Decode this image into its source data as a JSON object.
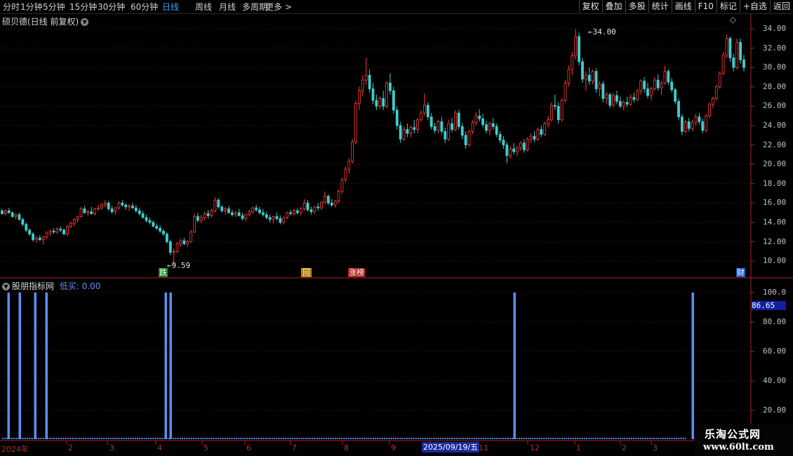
{
  "toolbar": {
    "periods": [
      "分时",
      "1分钟",
      "5分钟",
      "15分钟",
      "30分钟",
      "60分钟",
      "日线",
      "周线",
      "月线",
      "多周期",
      "更多 >"
    ],
    "active_period": "日线",
    "right_buttons": [
      "复权",
      "叠加",
      "多股",
      "统计",
      "画线",
      "F10",
      "标记",
      "+自选",
      "返回"
    ]
  },
  "main_panel": {
    "title": "硕贝德(日线 前复权)",
    "y_ticks": [
      "34.00",
      "32.00",
      "30.00",
      "28.00",
      "26.00",
      "24.00",
      "22.00",
      "20.00",
      "18.00",
      "16.00",
      "14.00",
      "12.00",
      "10.00"
    ],
    "max_label": "34.00",
    "min_label": "9.59",
    "event_tags": [
      {
        "text": "跌",
        "bg": "#1a8a1a"
      },
      {
        "text": "回",
        "bg": "#a07000"
      },
      {
        "text": "涨榜",
        "bg": "#b02020"
      },
      {
        "text": "财",
        "bg": "#1c5cc8"
      }
    ]
  },
  "indicator_panel": {
    "name": "股朋指标网",
    "series_label": "低买: 0.00",
    "y_ticks": [
      "100.0",
      "80.00",
      "60.00",
      "40.00",
      "20.00"
    ],
    "cursor_value": "86.65",
    "bar_color": "#5b8ff0"
  },
  "time_axis": {
    "labels": [
      "2024年",
      "2",
      "3",
      "4",
      "5",
      "6",
      "7",
      "8",
      "9",
      "11",
      "12",
      "1",
      "2",
      "3"
    ],
    "cursor_date": "2025/09/19/五"
  },
  "watermark": {
    "line1": "乐淘公式网",
    "line2": "www.60lt.com"
  },
  "chart_data": {
    "type": "candlestick",
    "title": "硕贝德(日线 前复权)",
    "ylim": [
      9.5,
      34.5
    ],
    "up_color": "#ff3c3c",
    "down_color": "#3ecfcf",
    "candles_ohlc": [
      [
        15.2,
        15.4,
        14.8,
        14.9
      ],
      [
        14.9,
        15.3,
        14.7,
        15.2
      ],
      [
        15.2,
        15.5,
        14.9,
        15.0
      ],
      [
        15.0,
        15.1,
        14.5,
        14.6
      ],
      [
        14.6,
        14.9,
        14.3,
        14.8
      ],
      [
        14.8,
        15.0,
        14.2,
        14.3
      ],
      [
        14.3,
        14.5,
        13.6,
        13.8
      ],
      [
        13.8,
        14.0,
        13.0,
        13.2
      ],
      [
        13.2,
        13.4,
        12.6,
        12.8
      ],
      [
        12.8,
        13.0,
        12.0,
        12.2
      ],
      [
        12.2,
        12.6,
        11.9,
        12.4
      ],
      [
        12.4,
        12.7,
        12.1,
        12.2
      ],
      [
        12.2,
        12.6,
        11.7,
        12.5
      ],
      [
        12.5,
        13.1,
        12.3,
        12.9
      ],
      [
        12.9,
        13.3,
        12.6,
        13.1
      ],
      [
        13.1,
        13.4,
        12.8,
        13.0
      ],
      [
        13.0,
        13.5,
        12.8,
        13.3
      ],
      [
        13.3,
        13.6,
        13.0,
        13.2
      ],
      [
        13.2,
        13.4,
        12.7,
        12.8
      ],
      [
        12.8,
        13.7,
        12.6,
        13.6
      ],
      [
        13.6,
        14.1,
        13.4,
        13.9
      ],
      [
        13.9,
        14.4,
        13.6,
        14.3
      ],
      [
        14.3,
        14.7,
        14.0,
        14.6
      ],
      [
        14.6,
        15.6,
        14.5,
        15.4
      ],
      [
        15.4,
        15.7,
        14.9,
        15.0
      ],
      [
        15.0,
        15.3,
        14.7,
        15.1
      ],
      [
        15.1,
        15.6,
        14.8,
        14.9
      ],
      [
        14.9,
        15.5,
        14.7,
        15.4
      ],
      [
        15.4,
        15.8,
        15.2,
        15.5
      ],
      [
        15.5,
        16.0,
        15.3,
        15.8
      ],
      [
        15.8,
        16.3,
        15.5,
        16.0
      ],
      [
        16.0,
        16.2,
        15.2,
        15.4
      ],
      [
        15.4,
        15.7,
        14.9,
        15.1
      ],
      [
        15.1,
        15.6,
        14.8,
        15.5
      ],
      [
        15.5,
        16.2,
        15.3,
        16.0
      ],
      [
        16.0,
        16.3,
        15.6,
        15.8
      ],
      [
        15.8,
        16.0,
        15.3,
        15.6
      ],
      [
        15.6,
        15.9,
        15.2,
        15.7
      ],
      [
        15.7,
        16.0,
        15.4,
        15.5
      ],
      [
        15.5,
        15.8,
        15.0,
        15.2
      ],
      [
        15.2,
        15.5,
        14.7,
        14.9
      ],
      [
        14.9,
        15.2,
        14.4,
        14.5
      ],
      [
        14.5,
        14.8,
        14.0,
        14.2
      ],
      [
        14.2,
        14.5,
        13.8,
        14.0
      ],
      [
        14.0,
        14.2,
        13.5,
        13.6
      ],
      [
        13.6,
        13.9,
        13.2,
        13.4
      ],
      [
        13.4,
        13.7,
        12.9,
        13.1
      ],
      [
        13.1,
        13.3,
        12.6,
        12.8
      ],
      [
        12.8,
        13.0,
        11.8,
        12.0
      ],
      [
        12.0,
        12.2,
        10.6,
        10.9
      ],
      [
        10.9,
        11.3,
        9.59,
        11.0
      ],
      [
        11.0,
        12.0,
        10.8,
        11.8
      ],
      [
        11.8,
        12.3,
        11.5,
        12.1
      ],
      [
        12.1,
        12.4,
        11.6,
        11.8
      ],
      [
        11.8,
        12.2,
        11.5,
        12.0
      ],
      [
        12.0,
        13.2,
        11.9,
        13.0
      ],
      [
        13.0,
        14.9,
        12.9,
        14.6
      ],
      [
        14.6,
        15.0,
        14.0,
        14.2
      ],
      [
        14.2,
        14.8,
        13.9,
        14.5
      ],
      [
        14.5,
        15.1,
        14.2,
        14.9
      ],
      [
        14.9,
        15.3,
        14.4,
        14.7
      ],
      [
        14.7,
        15.4,
        14.5,
        15.2
      ],
      [
        15.2,
        16.6,
        15.0,
        16.3
      ],
      [
        16.3,
        16.5,
        15.4,
        15.6
      ],
      [
        15.6,
        15.8,
        15.0,
        15.2
      ],
      [
        15.2,
        15.6,
        14.8,
        15.4
      ],
      [
        15.4,
        15.7,
        14.9,
        15.0
      ],
      [
        15.0,
        15.3,
        14.6,
        14.8
      ],
      [
        14.8,
        15.2,
        14.5,
        15.0
      ],
      [
        15.0,
        15.4,
        14.6,
        14.7
      ],
      [
        14.7,
        15.0,
        14.2,
        14.4
      ],
      [
        14.4,
        14.9,
        14.1,
        14.8
      ],
      [
        14.8,
        15.3,
        14.6,
        15.1
      ],
      [
        15.1,
        15.6,
        14.9,
        15.5
      ],
      [
        15.5,
        15.8,
        15.1,
        15.3
      ],
      [
        15.3,
        15.6,
        14.8,
        15.0
      ],
      [
        15.0,
        15.4,
        14.6,
        14.8
      ],
      [
        14.8,
        15.1,
        14.3,
        14.5
      ],
      [
        14.5,
        14.8,
        14.0,
        14.3
      ],
      [
        14.3,
        14.7,
        13.9,
        14.6
      ],
      [
        14.6,
        15.0,
        14.2,
        14.4
      ],
      [
        14.4,
        14.7,
        13.8,
        14.0
      ],
      [
        14.0,
        14.6,
        13.8,
        14.5
      ],
      [
        14.5,
        15.1,
        14.3,
        15.0
      ],
      [
        15.0,
        15.3,
        14.7,
        14.9
      ],
      [
        14.9,
        15.4,
        14.7,
        15.2
      ],
      [
        15.2,
        15.5,
        14.8,
        15.0
      ],
      [
        15.0,
        15.6,
        14.7,
        15.4
      ],
      [
        15.4,
        16.4,
        15.2,
        16.0
      ],
      [
        16.0,
        16.3,
        15.1,
        15.3
      ],
      [
        15.3,
        15.6,
        14.8,
        15.1
      ],
      [
        15.1,
        15.7,
        14.9,
        15.6
      ],
      [
        15.6,
        16.0,
        15.2,
        15.5
      ],
      [
        15.5,
        16.2,
        15.3,
        16.1
      ],
      [
        16.1,
        17.2,
        15.9,
        16.7
      ],
      [
        16.7,
        16.9,
        15.8,
        16.0
      ],
      [
        16.0,
        16.4,
        15.6,
        15.8
      ],
      [
        15.8,
        16.3,
        15.5,
        16.2
      ],
      [
        16.2,
        17.4,
        16.0,
        17.2
      ],
      [
        17.2,
        18.6,
        17.0,
        18.4
      ],
      [
        18.4,
        19.8,
        18.1,
        19.5
      ],
      [
        19.5,
        20.6,
        19.0,
        20.3
      ],
      [
        20.3,
        22.6,
        20.1,
        22.3
      ],
      [
        22.3,
        26.6,
        22.1,
        26.3
      ],
      [
        26.3,
        28.0,
        25.6,
        27.6
      ],
      [
        27.6,
        29.2,
        27.0,
        28.7
      ],
      [
        28.7,
        31.0,
        28.2,
        29.2
      ],
      [
        29.2,
        29.8,
        27.4,
        27.8
      ],
      [
        27.8,
        28.4,
        26.2,
        26.6
      ],
      [
        26.6,
        27.2,
        25.6,
        26.0
      ],
      [
        26.0,
        27.0,
        25.7,
        26.8
      ],
      [
        26.8,
        27.6,
        25.6,
        26.0
      ],
      [
        26.0,
        28.6,
        25.8,
        28.4
      ],
      [
        28.4,
        29.4,
        27.2,
        27.6
      ],
      [
        27.6,
        28.0,
        25.2,
        25.6
      ],
      [
        25.6,
        26.0,
        23.6,
        24.0
      ],
      [
        24.0,
        24.4,
        22.2,
        22.6
      ],
      [
        22.6,
        23.9,
        22.4,
        23.6
      ],
      [
        23.6,
        24.2,
        22.8,
        23.2
      ],
      [
        23.2,
        24.0,
        22.8,
        23.8
      ],
      [
        23.8,
        24.6,
        23.2,
        23.6
      ],
      [
        23.6,
        24.8,
        23.2,
        24.6
      ],
      [
        24.6,
        25.6,
        24.4,
        25.3
      ],
      [
        25.3,
        27.3,
        25.0,
        26.1
      ],
      [
        26.1,
        26.4,
        24.6,
        24.9
      ],
      [
        24.9,
        25.3,
        23.6,
        23.9
      ],
      [
        23.9,
        24.3,
        23.2,
        23.5
      ],
      [
        23.5,
        24.6,
        23.2,
        24.4
      ],
      [
        24.4,
        24.9,
        23.1,
        23.4
      ],
      [
        23.4,
        23.8,
        22.2,
        22.6
      ],
      [
        22.6,
        24.6,
        22.4,
        24.2
      ],
      [
        24.2,
        24.8,
        23.3,
        23.6
      ],
      [
        23.6,
        25.6,
        23.4,
        25.3
      ],
      [
        25.3,
        25.6,
        23.6,
        23.9
      ],
      [
        23.9,
        24.3,
        22.6,
        23.0
      ],
      [
        23.0,
        23.4,
        21.6,
        22.0
      ],
      [
        22.0,
        23.6,
        21.8,
        23.4
      ],
      [
        23.4,
        24.6,
        23.1,
        24.3
      ],
      [
        24.3,
        25.4,
        24.0,
        25.0
      ],
      [
        25.0,
        25.7,
        24.4,
        24.7
      ],
      [
        24.7,
        25.2,
        23.8,
        24.1
      ],
      [
        24.1,
        24.5,
        23.2,
        23.5
      ],
      [
        23.5,
        24.4,
        23.0,
        24.2
      ],
      [
        24.2,
        24.8,
        23.6,
        23.9
      ],
      [
        23.9,
        24.2,
        22.8,
        23.1
      ],
      [
        23.1,
        23.4,
        22.2,
        22.5
      ],
      [
        22.5,
        22.9,
        21.6,
        22.0
      ],
      [
        22.0,
        22.3,
        20.1,
        20.9
      ],
      [
        20.9,
        21.9,
        20.6,
        21.6
      ],
      [
        21.6,
        22.2,
        21.0,
        21.3
      ],
      [
        21.3,
        21.9,
        20.8,
        21.7
      ],
      [
        21.7,
        22.4,
        21.4,
        22.2
      ],
      [
        22.2,
        22.6,
        21.2,
        21.5
      ],
      [
        21.5,
        22.8,
        21.3,
        22.6
      ],
      [
        22.6,
        23.2,
        22.2,
        22.9
      ],
      [
        22.9,
        23.4,
        22.3,
        22.6
      ],
      [
        22.6,
        23.8,
        22.4,
        23.6
      ],
      [
        23.6,
        24.0,
        22.8,
        23.1
      ],
      [
        23.1,
        24.4,
        22.9,
        24.2
      ],
      [
        24.2,
        25.0,
        23.8,
        24.6
      ],
      [
        24.6,
        26.4,
        24.4,
        26.1
      ],
      [
        26.1,
        27.2,
        25.6,
        26.0
      ],
      [
        26.0,
        26.4,
        24.2,
        24.6
      ],
      [
        24.6,
        26.8,
        24.4,
        26.6
      ],
      [
        26.6,
        28.7,
        26.4,
        28.4
      ],
      [
        28.4,
        30.2,
        28.0,
        29.8
      ],
      [
        29.8,
        31.6,
        29.2,
        31.2
      ],
      [
        31.2,
        34.0,
        30.8,
        33.2
      ],
      [
        33.2,
        33.6,
        30.2,
        30.6
      ],
      [
        30.6,
        31.0,
        28.4,
        28.8
      ],
      [
        28.8,
        29.6,
        27.6,
        29.2
      ],
      [
        29.2,
        30.0,
        28.2,
        28.6
      ],
      [
        28.6,
        29.8,
        28.2,
        29.6
      ],
      [
        29.6,
        29.9,
        27.4,
        27.8
      ],
      [
        27.8,
        28.6,
        27.0,
        28.3
      ],
      [
        28.3,
        28.6,
        26.4,
        26.8
      ],
      [
        26.8,
        27.5,
        26.2,
        27.2
      ],
      [
        27.2,
        27.4,
        25.8,
        26.1
      ],
      [
        26.1,
        27.4,
        25.9,
        27.1
      ],
      [
        27.1,
        27.6,
        26.2,
        26.5
      ],
      [
        26.5,
        27.0,
        25.8,
        26.0
      ],
      [
        26.0,
        26.6,
        25.6,
        26.4
      ],
      [
        26.4,
        27.0,
        25.9,
        26.2
      ],
      [
        26.2,
        27.2,
        26.0,
        26.9
      ],
      [
        26.9,
        27.4,
        26.4,
        26.7
      ],
      [
        26.7,
        27.8,
        26.5,
        27.6
      ],
      [
        27.6,
        28.8,
        27.2,
        28.6
      ],
      [
        28.6,
        29.0,
        27.4,
        27.8
      ],
      [
        27.8,
        28.4,
        26.8,
        27.1
      ],
      [
        27.1,
        28.0,
        26.6,
        27.8
      ],
      [
        27.8,
        29.0,
        27.6,
        28.7
      ],
      [
        28.7,
        29.3,
        27.6,
        27.9
      ],
      [
        27.9,
        28.6,
        27.2,
        28.4
      ],
      [
        28.4,
        30.2,
        28.2,
        29.6
      ],
      [
        29.6,
        29.8,
        28.2,
        28.5
      ],
      [
        28.5,
        28.9,
        27.4,
        27.7
      ],
      [
        27.7,
        27.9,
        26.2,
        26.5
      ],
      [
        26.5,
        26.8,
        24.6,
        24.9
      ],
      [
        24.9,
        25.2,
        23.0,
        23.4
      ],
      [
        23.4,
        24.6,
        23.2,
        24.4
      ],
      [
        24.4,
        24.8,
        23.4,
        23.7
      ],
      [
        23.7,
        24.6,
        23.4,
        24.3
      ],
      [
        24.3,
        25.2,
        24.0,
        24.9
      ],
      [
        24.9,
        25.3,
        24.1,
        24.4
      ],
      [
        24.4,
        24.7,
        23.2,
        23.5
      ],
      [
        23.5,
        25.2,
        23.3,
        25.0
      ],
      [
        25.0,
        26.4,
        24.8,
        26.2
      ],
      [
        26.2,
        27.0,
        25.8,
        26.8
      ],
      [
        26.8,
        28.2,
        26.6,
        28.0
      ],
      [
        28.0,
        29.6,
        27.8,
        29.4
      ],
      [
        29.4,
        31.6,
        29.2,
        31.3
      ],
      [
        31.3,
        33.4,
        31.0,
        33.0
      ],
      [
        33.0,
        33.2,
        30.6,
        31.0
      ],
      [
        31.0,
        31.4,
        29.6,
        30.0
      ],
      [
        30.0,
        33.0,
        29.8,
        32.6
      ],
      [
        32.6,
        33.0,
        30.4,
        30.8
      ],
      [
        30.8,
        31.3,
        29.6,
        30.0
      ]
    ],
    "indicator": {
      "name": "股朋指标网",
      "series": [
        {
          "name": "低买",
          "type": "spike",
          "value": 100,
          "spike_positions": [
            3,
            9,
            18,
            25,
            90,
            93,
            281,
            378
          ]
        }
      ],
      "ylim": [
        0,
        110
      ],
      "total_bars": 380
    }
  }
}
